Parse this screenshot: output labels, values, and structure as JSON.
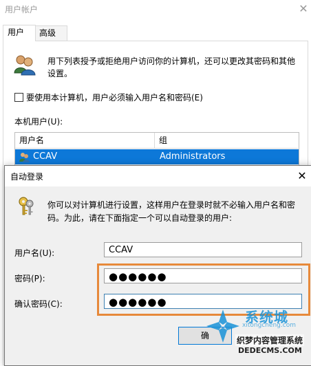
{
  "user_accounts": {
    "title": "用户帐户",
    "close_glyph": "✕",
    "tabs": [
      {
        "label": "用户",
        "selected": true
      },
      {
        "label": "高级",
        "selected": false
      }
    ],
    "description": "用下列表授予或拒绝用户访问你的计算机，还可以更改其密码和其他设置。",
    "must_login_checkbox": {
      "label": "要使用本计算机，用户必须输入用户名和密码(E)",
      "checked": false
    },
    "local_users_label": "本机用户(U):",
    "table": {
      "columns": [
        "用户名",
        "组"
      ],
      "rows": [
        {
          "name": "CCAV",
          "group": "Administrators",
          "selected": true
        }
      ]
    },
    "icons": {
      "users": "users-icon",
      "user_row": "user-icon"
    }
  },
  "auto_logon": {
    "title": "自动登录",
    "close_glyph": "✕",
    "description": "你可以对计算机进行设置，这样用户在登录时就不必输入用户名和密码。为此，请在下面指定一个可以自动登录的用户:",
    "fields": {
      "username": {
        "label": "用户名(U):",
        "value": "CCAV"
      },
      "password": {
        "label": "密码(P):",
        "value": "●●●●●●"
      },
      "confirm": {
        "label": "确认密码(C):",
        "value": "●●●●●●"
      }
    },
    "ok_button": "确",
    "icons": {
      "keys": "keys-icon"
    }
  },
  "watermark": {
    "brand": "系统城",
    "subtitle": "xitongcheng.com",
    "site_cn": "织梦内容管理系统",
    "site_en": "DEDECMS.COM"
  },
  "colors": {
    "selection": "#0d78d8",
    "highlight_box": "#e7893a",
    "focus_border": "#0078d7",
    "watermark_blue": "#1a93d8"
  }
}
